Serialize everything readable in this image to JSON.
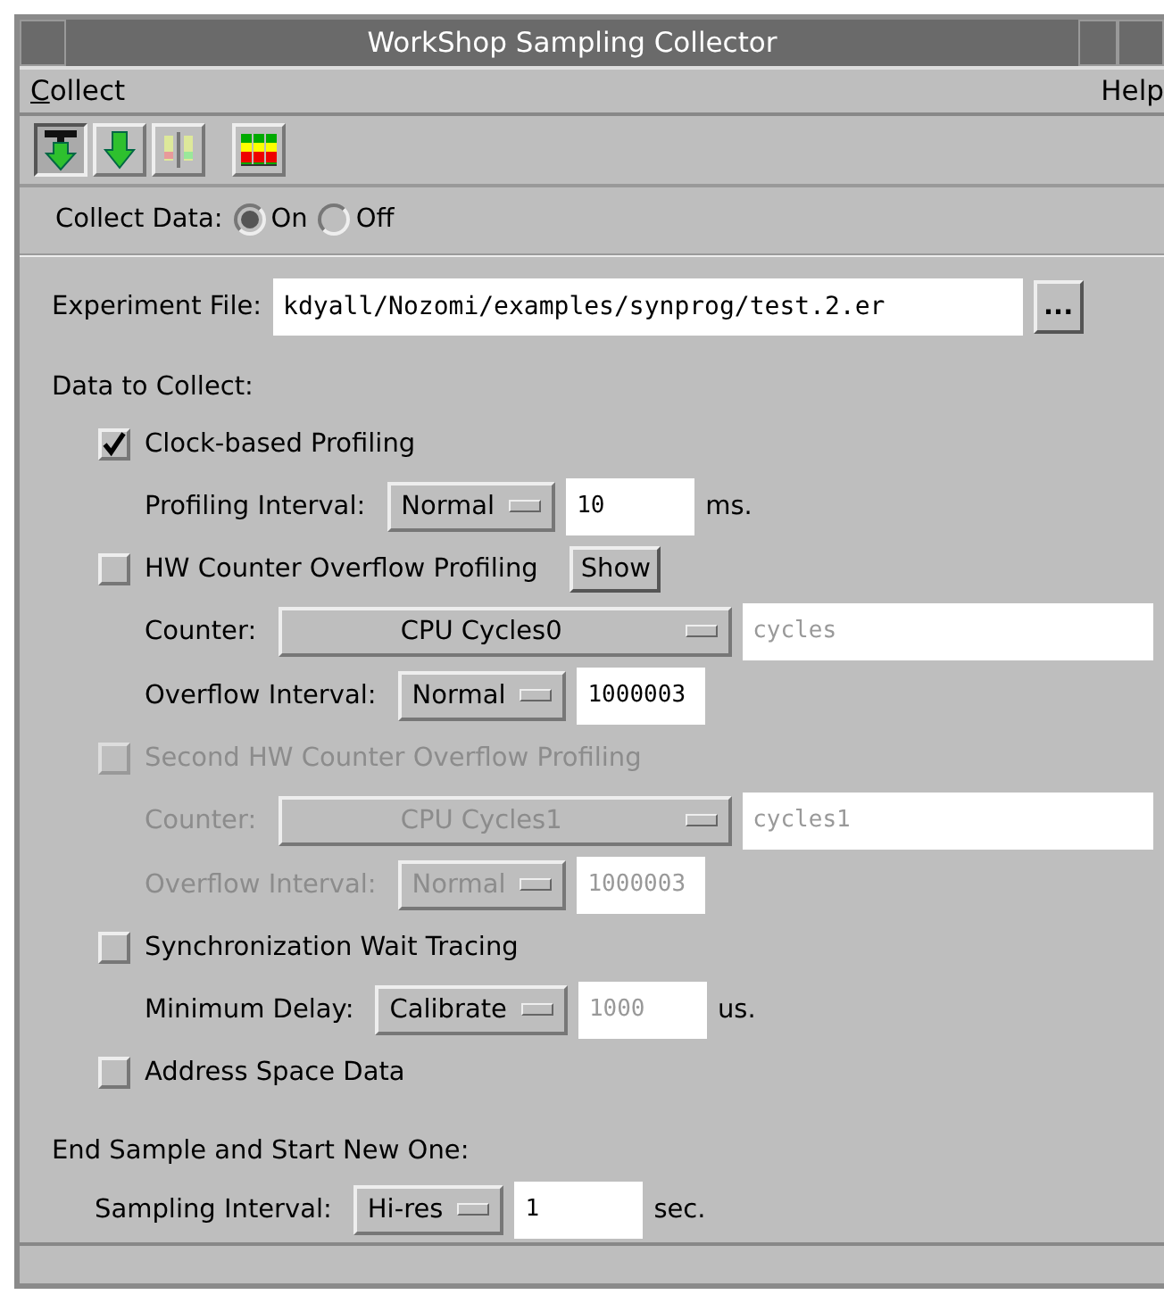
{
  "window": {
    "title": "WorkShop Sampling Collector"
  },
  "menu": [
    {
      "label": "Collect"
    },
    {
      "label": "Help"
    }
  ],
  "toolbar": [
    {
      "kind": "bar-arrow",
      "pressed": true
    },
    {
      "kind": "arrow",
      "pressed": false
    },
    {
      "kind": "meter-faded",
      "pressed": false
    },
    {
      "kind": "meter",
      "pressed": false
    }
  ],
  "collect_data": {
    "label": "Collect Data:",
    "options": [
      {
        "label": "On",
        "selected": true
      },
      {
        "label": "Off",
        "selected": false
      }
    ]
  },
  "experiment_file": {
    "label": "Experiment File:",
    "value": "kdyall/Nozomi/examples/synprog/test.2.er",
    "button": "..."
  },
  "data_to_collect": {
    "heading": "Data to Collect:",
    "rows": [
      {
        "kind": "check",
        "label": "Clock-based Profiling",
        "checked": true,
        "disabled": false
      },
      {
        "kind": "setting",
        "label": "Profiling Interval:",
        "choice": "Normal",
        "value": "10",
        "value_disabled": false,
        "unit": "ms.",
        "disabled": false
      },
      {
        "kind": "check",
        "label": "HW Counter Overflow Profiling",
        "checked": false,
        "disabled": false,
        "button": "Show"
      },
      {
        "kind": "counter",
        "label": "Counter:",
        "choice": "CPU Cycles0",
        "value": "cycles",
        "value_disabled": true,
        "disabled": false
      },
      {
        "kind": "setting",
        "label": "Overflow Interval:",
        "choice": "Normal",
        "value": "1000003",
        "value_disabled": false,
        "disabled": false
      },
      {
        "kind": "check",
        "label": "Second HW Counter Overflow Profiling",
        "checked": false,
        "disabled": true
      },
      {
        "kind": "counter",
        "label": "Counter:",
        "choice": "CPU Cycles1",
        "value": "cycles1",
        "value_disabled": true,
        "disabled": true
      },
      {
        "kind": "setting",
        "label": "Overflow Interval:",
        "choice": "Normal",
        "value": "1000003",
        "value_disabled": true,
        "disabled": true
      },
      {
        "kind": "check",
        "label": "Synchronization Wait Tracing",
        "checked": false,
        "disabled": false
      },
      {
        "kind": "setting",
        "label": "Minimum Delay:",
        "choice": "Calibrate",
        "value": "1000",
        "value_disabled": true,
        "unit": "us.",
        "disabled": false
      },
      {
        "kind": "check",
        "label": "Address Space Data",
        "checked": false,
        "disabled": false
      }
    ]
  },
  "sampling": {
    "heading": "End Sample and Start New One:",
    "label": "Sampling Interval:",
    "choice": "Hi-res",
    "value": "1",
    "unit": "sec."
  }
}
